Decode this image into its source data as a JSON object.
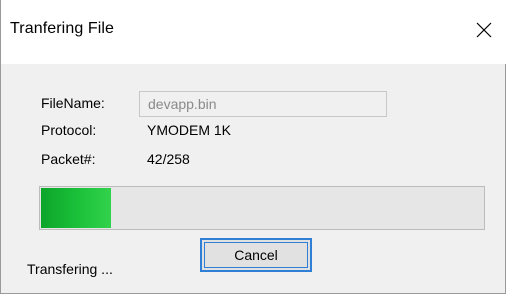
{
  "window": {
    "title": "Tranfering File",
    "close_icon": "close-icon"
  },
  "fields": {
    "filename_label": "FileName:",
    "filename_value": "devapp.bin",
    "protocol_label": "Protocol:",
    "protocol_value": "YMODEM 1K",
    "packet_label": "Packet#:",
    "packet_value": "42/258"
  },
  "progress": {
    "fraction": 0.163,
    "fill_color": "#1cc23a"
  },
  "buttons": {
    "cancel_label": "Cancel"
  },
  "status": {
    "text": "Transfering ..."
  }
}
